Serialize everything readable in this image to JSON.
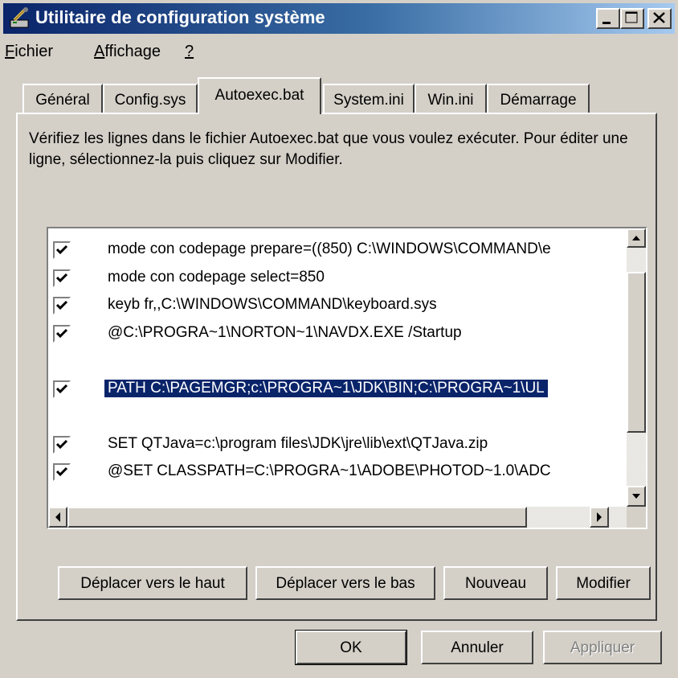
{
  "window": {
    "title": "Utilitaire de configuration système"
  },
  "menu": {
    "items": [
      "Fichier",
      "Affichage",
      "?"
    ]
  },
  "tabs": [
    "Général",
    "Config.sys",
    "Autoexec.bat",
    "System.ini",
    "Win.ini",
    "Démarrage"
  ],
  "active_tab": "Autoexec.bat",
  "description": "Vérifiez les lignes dans le fichier Autoexec.bat que vous voulez exécuter. Pour éditer une ligne, sélectionnez-la puis cliquez sur Modifier.",
  "lines": [
    {
      "checked": true,
      "text": "mode con codepage prepare=((850) C:\\WINDOWS\\COMMAND\\e",
      "selected": false
    },
    {
      "checked": true,
      "text": "mode con codepage select=850",
      "selected": false
    },
    {
      "checked": true,
      "text": "keyb fr,,C:\\WINDOWS\\COMMAND\\keyboard.sys",
      "selected": false
    },
    {
      "checked": true,
      "text": "@C:\\PROGRA~1\\NORTON~1\\NAVDX.EXE /Startup",
      "selected": false
    },
    {
      "checked": null,
      "text": "",
      "selected": false
    },
    {
      "checked": true,
      "text": "PATH C:\\PAGEMGR;c:\\PROGRA~1\\JDK\\BIN;C:\\PROGRA~1\\UL",
      "selected": true
    },
    {
      "checked": null,
      "text": "",
      "selected": false
    },
    {
      "checked": true,
      "text": "SET QTJava=c:\\program files\\JDK\\jre\\lib\\ext\\QTJava.zip",
      "selected": false
    },
    {
      "checked": true,
      "text": "@SET CLASSPATH=C:\\PROGRA~1\\ADOBE\\PHOTOD~1.0\\ADC",
      "selected": false
    }
  ],
  "buttons": {
    "move_up": "Déplacer vers le haut",
    "move_down": "Déplacer vers le bas",
    "new": "Nouveau",
    "edit": "Modifier",
    "ok": "OK",
    "cancel": "Annuler",
    "apply": "Appliquer"
  },
  "colors": {
    "title_start": "#0a246a",
    "title_end": "#a6caf0",
    "face": "#d4d0c8",
    "selection": "#0a246a"
  }
}
